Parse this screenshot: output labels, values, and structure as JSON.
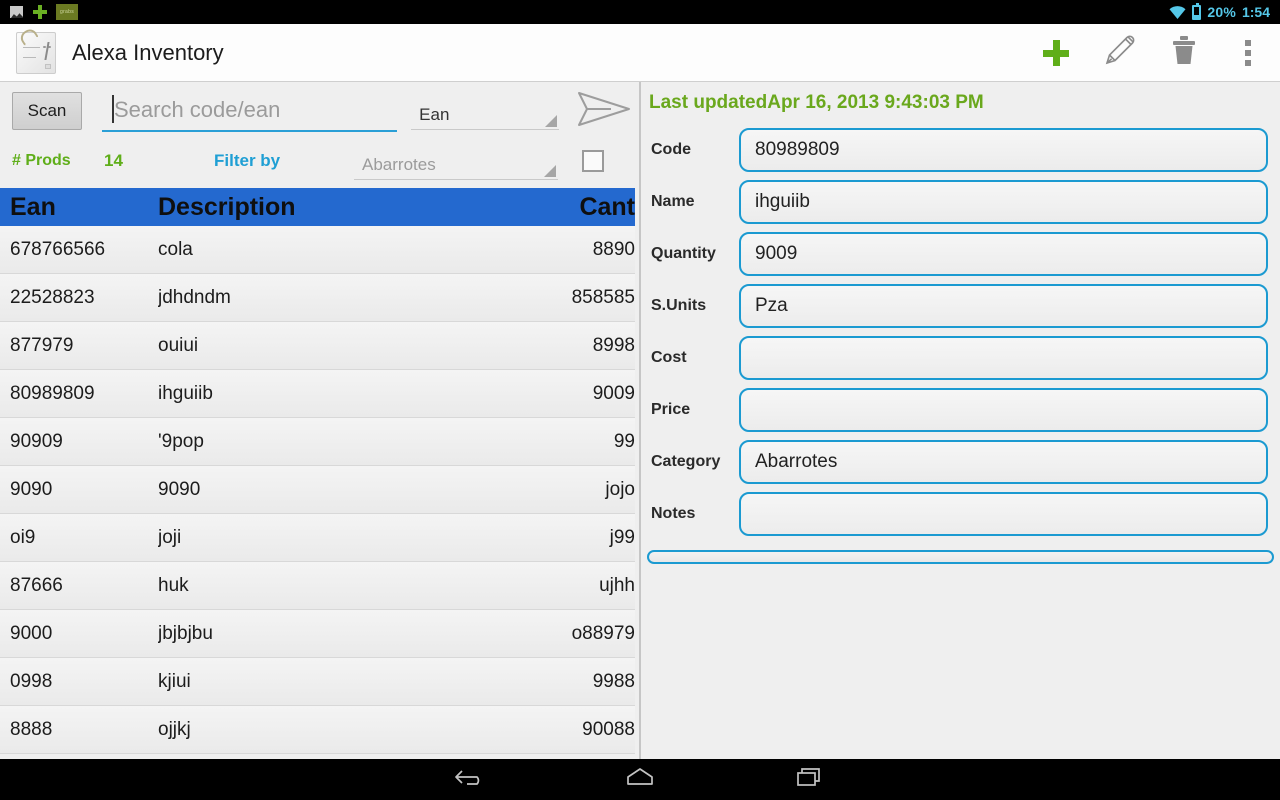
{
  "statusbar": {
    "left_icons": [
      "screenshot-icon",
      "add-icon",
      "app-badge"
    ],
    "badge_text": "grabs",
    "wifi_icon": "wifi-icon",
    "battery_icon": "battery-icon",
    "battery_percent": "20%",
    "time": "1:54",
    "accent_color": "#55c7e8"
  },
  "actionbar": {
    "app_icon": "clipboard-icon",
    "title": "Alexa Inventory",
    "actions": [
      {
        "name": "add-button",
        "icon": "plus-icon",
        "color": "#5fae19"
      },
      {
        "name": "edit-button",
        "icon": "pencil-icon",
        "color": "#8b8b8b"
      },
      {
        "name": "delete-button",
        "icon": "trash-icon",
        "color": "#8b8b8b"
      },
      {
        "name": "overflow-menu-button",
        "icon": "overflow-dots-icon",
        "color": "#8b8b8b"
      }
    ]
  },
  "search": {
    "scan_label": "Scan",
    "input_value": "",
    "placeholder": "Search code/ean",
    "field_type_selected": "Ean",
    "send_icon": "send-paper-plane-icon",
    "underline_color": "#2a9fd6"
  },
  "meta": {
    "prods_label": "# Prods",
    "prods_count": "14",
    "filter_label": "Filter by",
    "filter_selected": "Abarrotes",
    "checkbox_checked": false,
    "prods_color": "#5fae19",
    "filter_color": "#1f9fd4"
  },
  "table": {
    "header_bg": "#2469cf",
    "columns": [
      "Ean",
      "Description",
      "Cant"
    ],
    "rows": [
      {
        "ean": "678766566",
        "description": "cola",
        "cant": "8890"
      },
      {
        "ean": "22528823",
        "description": "jdhdndm",
        "cant": "858585"
      },
      {
        "ean": "877979",
        "description": "ouiui",
        "cant": "8998"
      },
      {
        "ean": "80989809",
        "description": "ihguiib",
        "cant": "9009"
      },
      {
        "ean": "90909",
        "description": "'9pop",
        "cant": "99"
      },
      {
        "ean": "9090",
        "description": "9090",
        "cant": "jojo"
      },
      {
        "ean": "oi9",
        "description": "joji",
        "cant": "j99"
      },
      {
        "ean": "87666",
        "description": "huk",
        "cant": "ujhh"
      },
      {
        "ean": "9000",
        "description": "jbjbjbu",
        "cant": "o88979"
      },
      {
        "ean": "0998",
        "description": "kjiui",
        "cant": "9988"
      },
      {
        "ean": "8888",
        "description": "ojjkj",
        "cant": "90088"
      }
    ]
  },
  "detail": {
    "last_updated": "Last updatedApr 16, 2013 9:43:03 PM",
    "last_updated_color": "#6aa81d",
    "field_border_color": "#1b9ad1",
    "fields": [
      {
        "label": "Code",
        "value": "80989809"
      },
      {
        "label": "Name",
        "value": "ihguiib"
      },
      {
        "label": "Quantity",
        "value": "9009"
      },
      {
        "label": "S.Units",
        "value": "Pza"
      },
      {
        "label": "Cost",
        "value": ""
      },
      {
        "label": "Price",
        "value": ""
      },
      {
        "label": "Category",
        "value": "Abarrotes"
      },
      {
        "label": "Notes",
        "value": ""
      }
    ]
  },
  "navbar": {
    "buttons": [
      {
        "name": "back-button",
        "icon": "back-arrow-icon"
      },
      {
        "name": "home-button",
        "icon": "home-icon"
      },
      {
        "name": "recents-button",
        "icon": "recents-icon"
      }
    ]
  }
}
